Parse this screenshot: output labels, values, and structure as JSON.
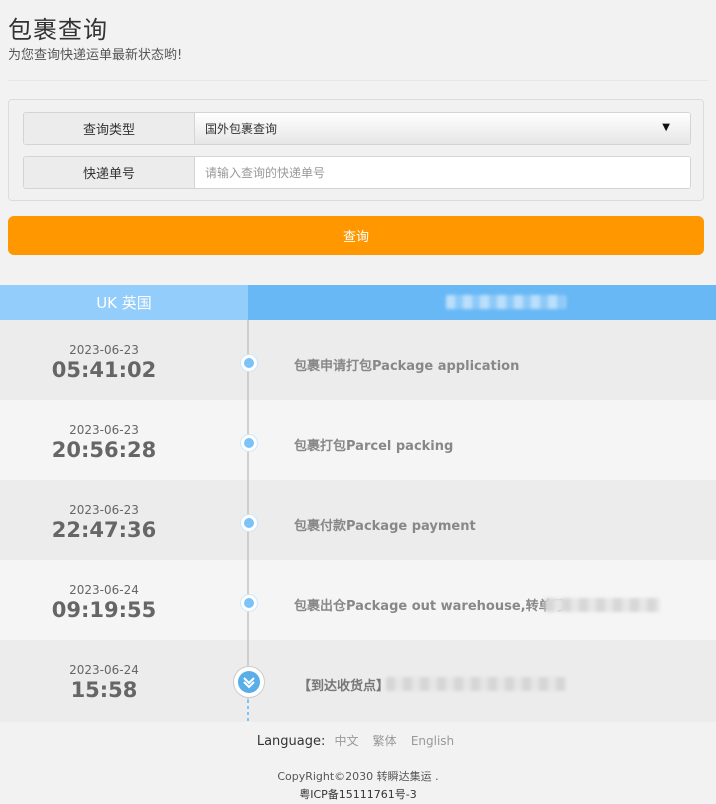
{
  "header": {
    "title": "包裹查询",
    "subtitle": "为您查询快递运单最新状态哟!"
  },
  "form": {
    "type_label": "查询类型",
    "type_value": "国外包裹查询",
    "number_label": "快递单号",
    "number_placeholder": "请输入查询的快递单号",
    "number_value": "",
    "submit_label": "查询"
  },
  "result": {
    "origin_label": "UK 英国",
    "events": [
      {
        "date": "2023-06-23",
        "time": "05:41:02",
        "desc": "包裹申请打包Package application"
      },
      {
        "date": "2023-06-23",
        "time": "20:56:28",
        "desc": "包裹打包Parcel packing"
      },
      {
        "date": "2023-06-23",
        "time": "22:47:36",
        "desc": "包裹付款Package payment"
      },
      {
        "date": "2023-06-24",
        "time": "09:19:55",
        "desc": "包裹出仓Package out warehouse,转单号"
      },
      {
        "date": "2023-06-24",
        "time": "15:58",
        "desc": "【到达收货点】"
      }
    ]
  },
  "footer": {
    "language_label": "Language:",
    "languages": [
      "中文",
      "繁体",
      "English"
    ],
    "copyright": "CopyRight©2030 转瞬达集运 .",
    "icp": "粤ICP备15111761号-3"
  },
  "colors": {
    "accent_orange": "#ff9800",
    "header_blue_light": "#93cdfb",
    "header_blue": "#68b8f6",
    "dot_blue": "#7cc3f7"
  }
}
